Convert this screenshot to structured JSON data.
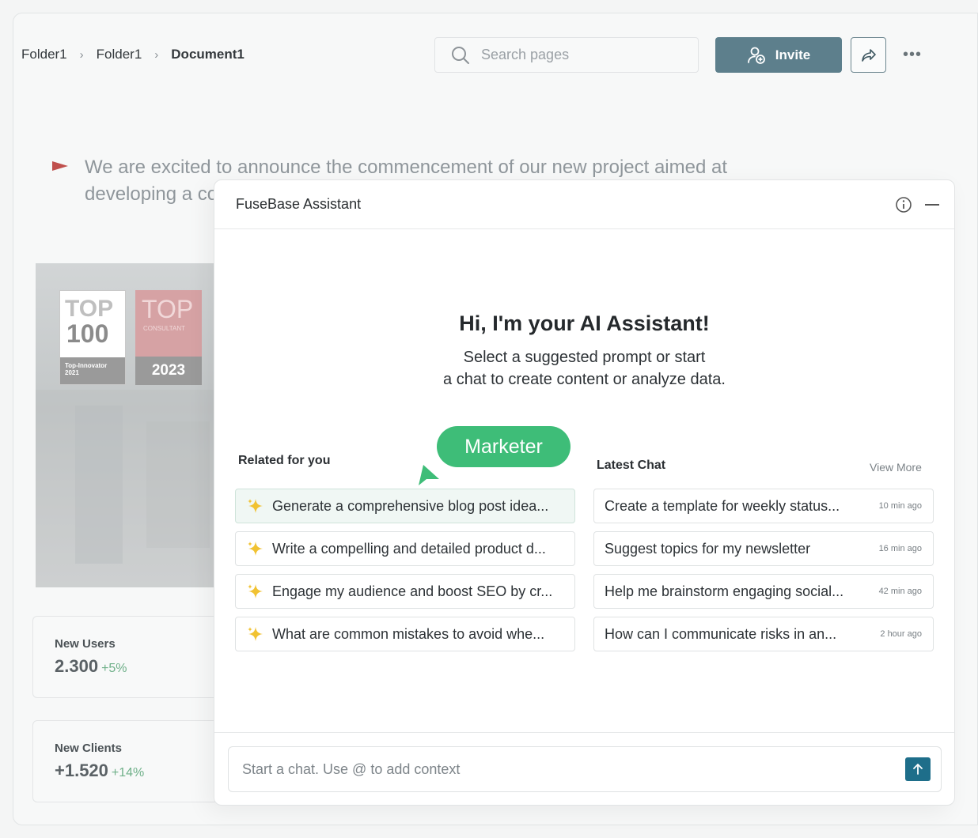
{
  "breadcrumb": {
    "items": [
      "Folder1",
      "Folder1"
    ],
    "current": "Document1"
  },
  "search": {
    "placeholder": "Search pages"
  },
  "header": {
    "invite_label": "Invite"
  },
  "document": {
    "text": "We are excited to announce the commencement of our new project aimed at developing a co"
  },
  "photo": {
    "badge1": {
      "top": "TOP",
      "number": "100",
      "footer_line1": "Top-Innovator",
      "footer_line2": "2021"
    },
    "badge2": {
      "top": "TOP",
      "small": "CONSULTANT",
      "year": "2023"
    }
  },
  "stats": [
    {
      "label": "New Users",
      "value": "2.300",
      "delta": "+5%"
    },
    {
      "label": "New Clients",
      "value": "+1.520",
      "delta": "+14%"
    }
  ],
  "assistant": {
    "title": "FuseBase Assistant",
    "hero_title": "Hi, I'm your AI Assistant!",
    "hero_sub_line1": "Select a suggested prompt or start",
    "hero_sub_line2": "a chat to create content or analyze data.",
    "related_label": "Related for you",
    "latest_label": "Latest Chat",
    "view_more": "View More",
    "marketer": "Marketer",
    "prompts": [
      "Generate a comprehensive blog post idea...",
      "Write a compelling and detailed product d...",
      "Engage my audience and boost SEO by cr...",
      " What are common mistakes to avoid whe..."
    ],
    "chats": [
      {
        "title": "Create a template for weekly status...",
        "time": "10 min ago"
      },
      {
        "title": "Suggest topics for my newsletter",
        "time": "16 min ago"
      },
      {
        "title": "Help me brainstorm engaging social...",
        "time": "42 min ago"
      },
      {
        "title": "How can I  communicate risks in an...",
        "time": "2 hour ago"
      }
    ],
    "composer_placeholder": "Start a chat. Use @ to add context"
  },
  "colors": {
    "accent": "#5d7f8c",
    "marketer": "#3ebd78",
    "send": "#1e6e8a",
    "flag": "#c0504d"
  }
}
